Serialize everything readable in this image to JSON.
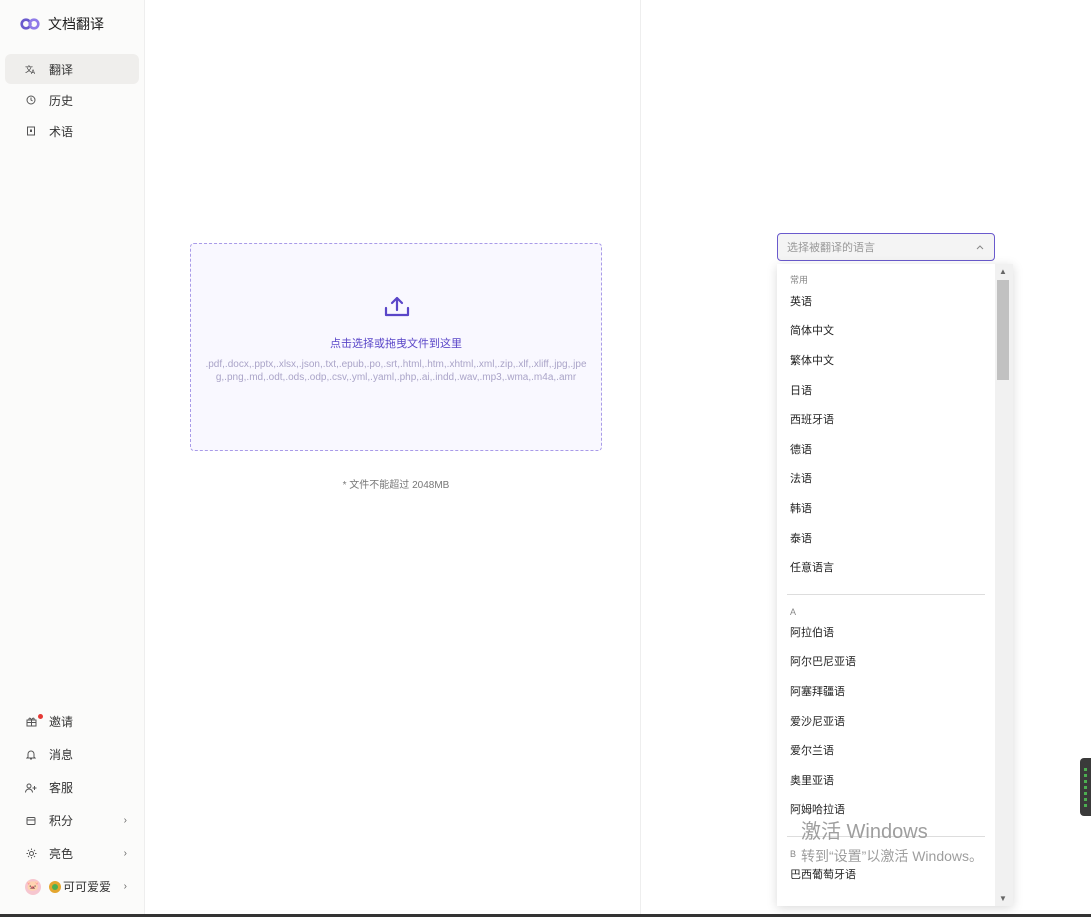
{
  "app": {
    "title": "文档翻译"
  },
  "sidebar": {
    "items": [
      {
        "label": "翻译"
      },
      {
        "label": "历史"
      },
      {
        "label": "术语"
      }
    ],
    "bottom_items": [
      {
        "label": "邀请"
      },
      {
        "label": "消息"
      },
      {
        "label": "客服"
      },
      {
        "label": "积分"
      },
      {
        "label": "亮色"
      }
    ],
    "user": {
      "name": "可可爱爱"
    }
  },
  "upload": {
    "title": "点击选择或拖曳文件到这里",
    "formats": ".pdf,.docx,.pptx,.xlsx,.json,.txt,.epub,.po,.srt,.html,.htm,.xhtml,.xml,.zip,.xlf,.xliff,.jpg,.jpeg,.png,.md,.odt,.ods,.odp,.csv,.yml,.yaml,.php,.ai,.indd,.wav,.mp3,.wma,.m4a,.amr",
    "size_note": "* 文件不能超过 2048MB"
  },
  "language_select": {
    "placeholder": "选择被翻译的语言",
    "groups": [
      {
        "header": "常用",
        "items": [
          "英语",
          "简体中文",
          "繁体中文",
          "日语",
          "西班牙语",
          "德语",
          "法语",
          "韩语",
          "泰语",
          "任意语言"
        ]
      },
      {
        "header": "A",
        "items": [
          "阿拉伯语",
          "阿尔巴尼亚语",
          "阿塞拜疆语",
          "爱沙尼亚语",
          "爱尔兰语",
          "奥里亚语",
          "阿姆哈拉语"
        ]
      },
      {
        "header": "B",
        "items": [
          "巴西葡萄牙语"
        ]
      }
    ]
  },
  "watermark": {
    "title": "激活 Windows",
    "subtitle": "转到“设置”以激活 Windows。"
  },
  "colors": {
    "accent": "#6a5acd",
    "upload_bg": "#f9f8ff"
  }
}
